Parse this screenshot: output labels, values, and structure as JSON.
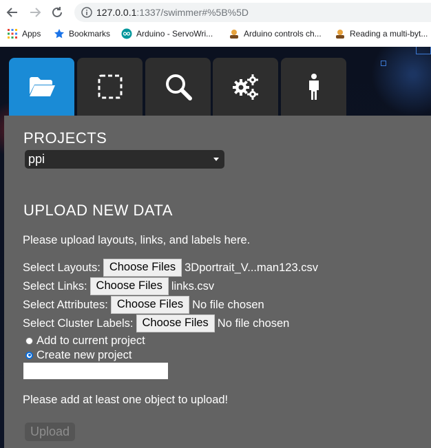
{
  "browser": {
    "url_host": "127.0.0.1",
    "url_rest": ":1337/swimmer#%5B%5D",
    "bookmarks": [
      {
        "label": "Apps",
        "icon": "apps-grid-icon"
      },
      {
        "label": "Bookmarks",
        "icon": "star-icon"
      },
      {
        "label": "Arduino - ServoWri...",
        "icon": "arduino-icon"
      },
      {
        "label": "Arduino controls ch...",
        "icon": "forum-avatar-icon"
      },
      {
        "label": "Reading a multi-byt...",
        "icon": "forum-avatar-icon"
      }
    ]
  },
  "tabs": [
    {
      "name": "folder-icon",
      "active": true
    },
    {
      "name": "selection-icon",
      "active": false
    },
    {
      "name": "search-icon",
      "active": false
    },
    {
      "name": "gears-icon",
      "active": false
    },
    {
      "name": "person-icon",
      "active": false
    }
  ],
  "projects": {
    "title": "PROJECTS",
    "selected": "ppi"
  },
  "upload": {
    "title": "UPLOAD NEW DATA",
    "instructions": "Please upload layouts, links, and labels here.",
    "layouts_label": "Select Layouts:",
    "layouts_file": "3Dportrait_V...man123.csv",
    "links_label": "Select Links:",
    "links_file": "links.csv",
    "attributes_label": "Select Attributes:",
    "attributes_file": "No file chosen",
    "cluster_label": "Select Cluster Labels:",
    "cluster_file": "No file chosen",
    "choose_label": "Choose Files",
    "radio_add": "Add to current project",
    "radio_create": "Create new project",
    "selected_option": "Create new project",
    "project_name_value": "",
    "warning": "Please add at least one object to upload!",
    "button": "Upload"
  },
  "colors": {
    "tab_active": "#1a8bd6",
    "tab_inactive": "#2e2e2e",
    "panel": "#636363"
  }
}
